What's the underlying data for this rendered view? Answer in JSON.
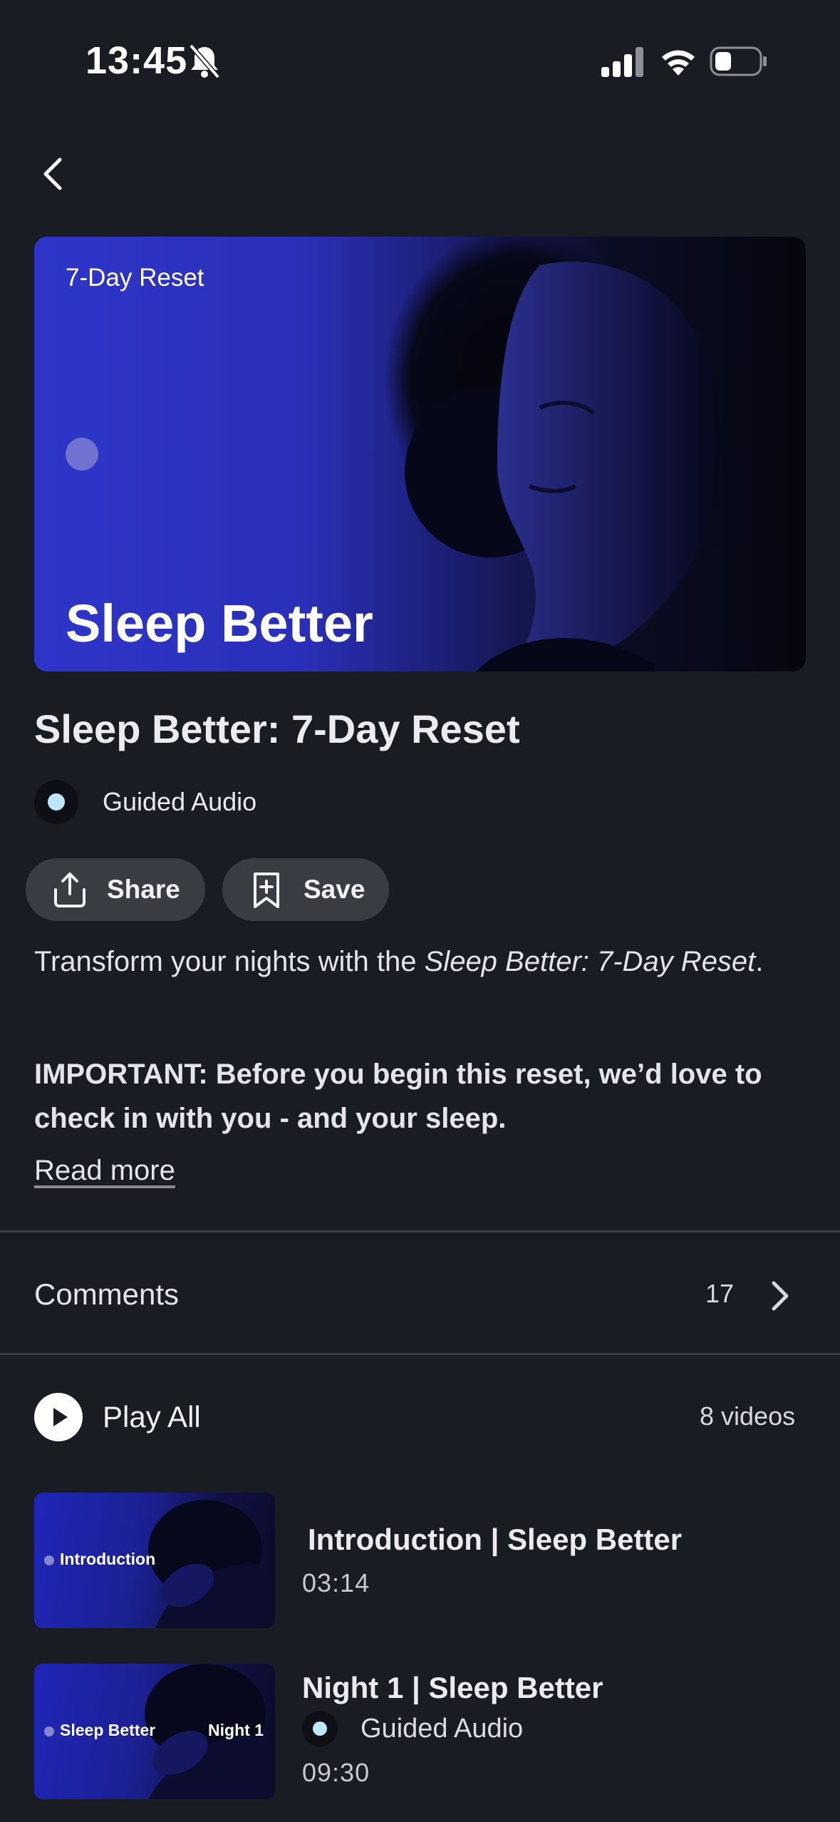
{
  "status_bar": {
    "time": "13:45",
    "icons": [
      "bell-slash-icon",
      "cellular-signal-icon",
      "wifi-icon",
      "battery-icon"
    ]
  },
  "hero": {
    "kicker": "7-Day Reset",
    "title": "Sleep Better"
  },
  "page": {
    "title": "Sleep Better: 7-Day Reset",
    "content_type": "Guided Audio",
    "accent_dot_color": "#bfe6ff"
  },
  "actions": {
    "share_label": "Share",
    "save_label": "Save"
  },
  "description": {
    "lead": "Transform your nights with the ",
    "emphasis": "Sleep Better: 7-Day Reset",
    "trail": ".",
    "important": "IMPORTANT: Before you begin this reset, we’d love to check in with you - and your sleep.",
    "read_more": "Read more"
  },
  "comments": {
    "label": "Comments",
    "count": "17"
  },
  "playlist": {
    "play_all_label": "Play All",
    "count_label": "8 videos",
    "items": [
      {
        "thumb_left_text": "Introduction",
        "thumb_right_text": "",
        "title": "Introduction | Sleep Better",
        "type": "",
        "duration": "03:14"
      },
      {
        "thumb_left_text": "Sleep Better",
        "thumb_right_text": "Night 1",
        "title": "Night 1 | Sleep Better",
        "type": "Guided Audio",
        "duration": "09:30"
      }
    ]
  }
}
